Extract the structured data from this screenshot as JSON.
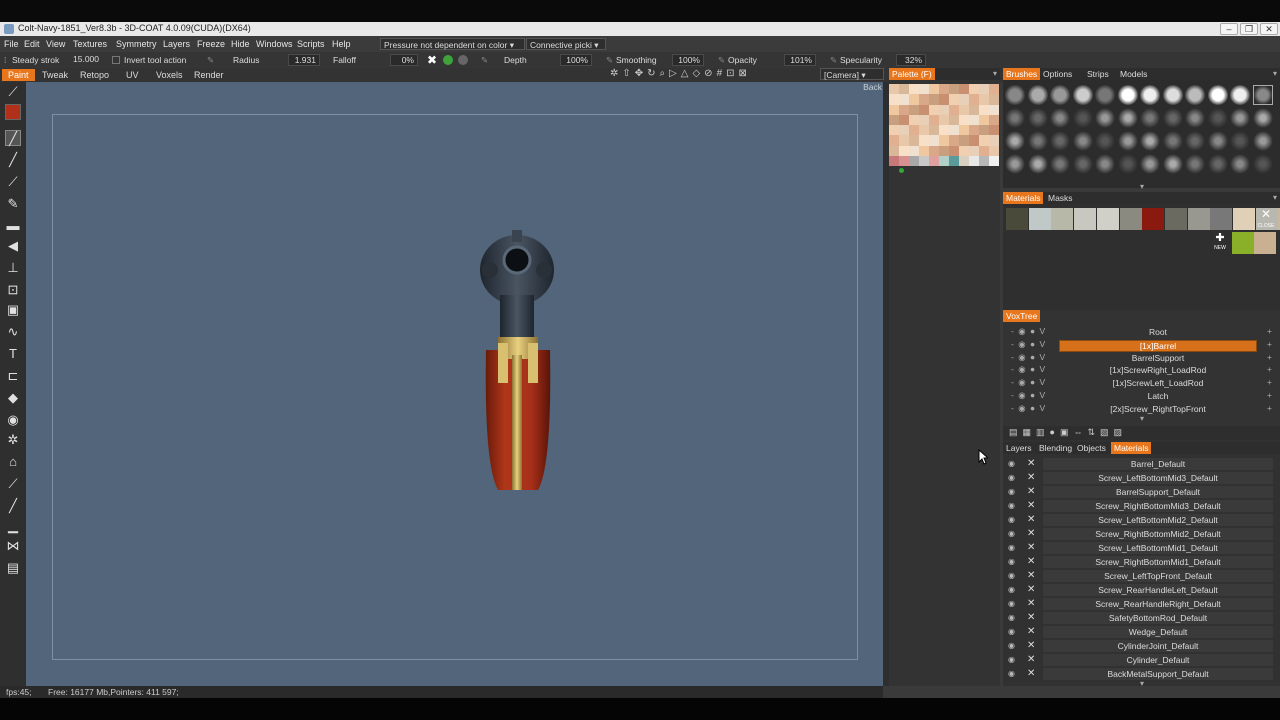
{
  "window": {
    "title": "Colt-Navy-1851_Ver8.3b - 3D-COAT 4.0.09(CUDA)(DX64)"
  },
  "menu": [
    "File",
    "Edit",
    "View",
    "Textures",
    "Symmetry",
    "Layers",
    "Freeze",
    "Hide",
    "Windows",
    "Scripts",
    "Help"
  ],
  "menu_dropdowns": {
    "pressure": "Pressure not dependent on color",
    "connective": "Connective picki"
  },
  "toolbar": {
    "steady_label": "Steady strok",
    "steady_value": "15.000",
    "invert_label": "Invert tool action",
    "radius_label": "Radius",
    "radius_value": "1.931",
    "falloff_label": "Falloff",
    "falloff_value": "0%",
    "depth_label": "Depth",
    "depth_value": "100%",
    "smoothing_label": "Smoothing",
    "smoothing_value": "100%",
    "opacity_label": "Opacity",
    "opacity_value": "101%",
    "specularity_label": "Specularity",
    "specularity_value": "32%"
  },
  "rooms": [
    "Paint",
    "Tweak",
    "Retopo",
    "UV",
    "Voxels",
    "Render"
  ],
  "active_room": "Paint",
  "camera_dropdown": "[Camera]",
  "viewport": {
    "view_label": "Back"
  },
  "status": {
    "fps": "fps:45;",
    "memory": "Free: 16177 Mb,Pointers: 411 597;"
  },
  "palette": {
    "tab": "Palette (F)"
  },
  "brushes": {
    "tabs": [
      "Brushes",
      "Options",
      "Strips",
      "Models"
    ],
    "active": "Brushes"
  },
  "materials_panel": {
    "tabs": [
      "Materials",
      "Masks"
    ],
    "active": "Materials",
    "close_label": "CLOSE",
    "new_label": "NEW"
  },
  "voxtree": {
    "tab": "VoxTree",
    "items": [
      {
        "name": "Root",
        "selected": false
      },
      {
        "name": "[1x]Barrel",
        "selected": true
      },
      {
        "name": "BarrelSupport",
        "selected": false
      },
      {
        "name": "[1x]ScrewRight_LoadRod",
        "selected": false
      },
      {
        "name": "[1x]ScrewLeft_LoadRod",
        "selected": false
      },
      {
        "name": "Latch",
        "selected": false
      },
      {
        "name": "[2x]Screw_RightTopFront",
        "selected": false
      }
    ]
  },
  "layers_tabs": {
    "tabs": [
      "Layers",
      "Blending",
      "Objects",
      "Materials"
    ],
    "active": "Materials"
  },
  "material_list": [
    "Barrel_Default",
    "Screw_LeftBottomMid3_Default",
    "BarrelSupport_Default",
    "Screw_RightBottomMid3_Default",
    "Screw_LeftBottomMid2_Default",
    "Screw_RightBottomMid2_Default",
    "Screw_LeftBottomMid1_Default",
    "Screw_RightBottomMid1_Default",
    "Screw_LeftTopFront_Default",
    "Screw_RearHandleLeft_Default",
    "Screw_RearHandleRight_Default",
    "SafetyBottomRod_Default",
    "Wedge_Default",
    "CylinderJoint_Default",
    "Cylinder_Default",
    "BackMetalSupport_Default"
  ],
  "colors": {
    "accent": "#e8761c",
    "viewport_bg": "#52657a",
    "wood": "#9a2a12",
    "brass": "#c8a848",
    "steel": "#3a4450"
  }
}
